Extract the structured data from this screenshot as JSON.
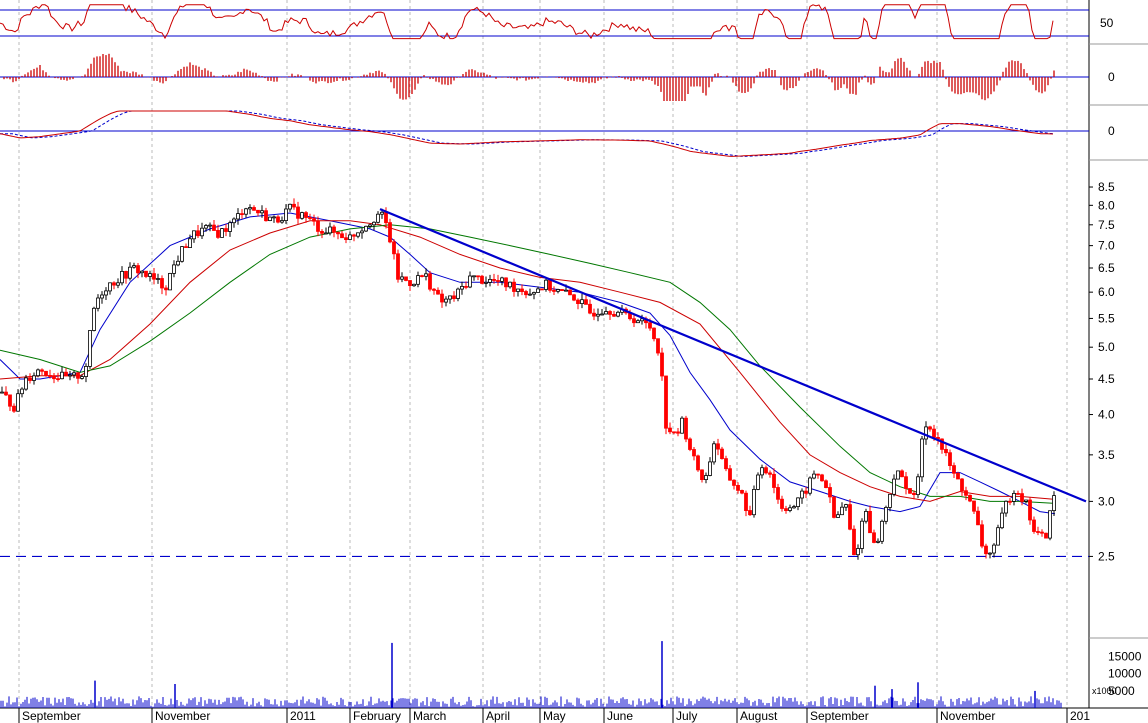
{
  "chart_data": [
    {
      "type": "line",
      "panel": "rsi",
      "y_ticks": [
        {
          "value": 50,
          "label": "50"
        }
      ],
      "reference_lines": [
        40,
        60
      ],
      "line_color": "#cc0000",
      "ref_color": "#0000cc"
    },
    {
      "type": "bar",
      "panel": "macd-histogram",
      "y_ticks": [
        {
          "value": 0,
          "label": "0"
        }
      ],
      "bar_color": "#cc0000"
    },
    {
      "type": "line",
      "panel": "macd",
      "y_ticks": [
        {
          "value": 0,
          "label": "0"
        }
      ],
      "line_color": "#cc0000",
      "signal_color": "#0000cc"
    },
    {
      "type": "candlestick",
      "panel": "price",
      "log_scale": true,
      "ylim": [
        2.2,
        8.7
      ],
      "y_ticks": [
        {
          "value": 8.5,
          "label": "8.5"
        },
        {
          "value": 8.0,
          "label": "8.0"
        },
        {
          "value": 7.5,
          "label": "7.5"
        },
        {
          "value": 7.0,
          "label": "7.0"
        },
        {
          "value": 6.5,
          "label": "6.5"
        },
        {
          "value": 6.0,
          "label": "6.0"
        },
        {
          "value": 5.5,
          "label": "5.5"
        },
        {
          "value": 5.0,
          "label": "5.0"
        },
        {
          "value": 4.5,
          "label": "4.5"
        },
        {
          "value": 4.0,
          "label": "4.0"
        },
        {
          "value": 3.5,
          "label": "3.5"
        },
        {
          "value": 3.0,
          "label": "3.0"
        },
        {
          "value": 2.5,
          "label": "2.5"
        }
      ],
      "trendline": [
        {
          "x": "2011-02-01",
          "y": 7.9
        },
        {
          "x": "2011-12-27",
          "y": 3.0
        }
      ],
      "support_level": 2.5,
      "moving_averages": [
        {
          "color": "#0000cc",
          "points": [
            [
              0,
              4.8
            ],
            [
              20,
              4.5
            ],
            [
              40,
              4.5
            ],
            [
              60,
              4.55
            ],
            [
              80,
              4.6
            ],
            [
              100,
              5.3
            ],
            [
              130,
              6.2
            ],
            [
              170,
              7.0
            ],
            [
              210,
              7.4
            ],
            [
              250,
              7.7
            ],
            [
              290,
              7.8
            ],
            [
              330,
              7.6
            ],
            [
              370,
              7.4
            ],
            [
              390,
              7.2
            ],
            [
              410,
              6.8
            ],
            [
              430,
              6.4
            ],
            [
              460,
              6.2
            ],
            [
              500,
              6.2
            ],
            [
              540,
              6.1
            ],
            [
              580,
              6.0
            ],
            [
              620,
              5.8
            ],
            [
              650,
              5.6
            ],
            [
              670,
              5.2
            ],
            [
              690,
              4.6
            ],
            [
              710,
              4.2
            ],
            [
              730,
              3.8
            ],
            [
              760,
              3.45
            ],
            [
              790,
              3.2
            ],
            [
              820,
              3.1
            ],
            [
              850,
              3.0
            ],
            [
              870,
              2.95
            ],
            [
              900,
              2.9
            ],
            [
              920,
              2.95
            ],
            [
              940,
              3.3
            ],
            [
              960,
              3.3
            ],
            [
              980,
              3.2
            ],
            [
              1000,
              3.1
            ],
            [
              1020,
              3.0
            ],
            [
              1040,
              2.9
            ],
            [
              1055,
              2.88
            ]
          ]
        },
        {
          "color": "#cc0000",
          "points": [
            [
              0,
              4.5
            ],
            [
              40,
              4.55
            ],
            [
              80,
              4.55
            ],
            [
              110,
              4.8
            ],
            [
              150,
              5.4
            ],
            [
              190,
              6.2
            ],
            [
              230,
              6.9
            ],
            [
              270,
              7.3
            ],
            [
              310,
              7.6
            ],
            [
              350,
              7.6
            ],
            [
              380,
              7.5
            ],
            [
              420,
              7.2
            ],
            [
              460,
              6.8
            ],
            [
              500,
              6.5
            ],
            [
              540,
              6.3
            ],
            [
              580,
              6.2
            ],
            [
              620,
              6.0
            ],
            [
              660,
              5.8
            ],
            [
              700,
              5.4
            ],
            [
              740,
              4.6
            ],
            [
              780,
              3.9
            ],
            [
              810,
              3.5
            ],
            [
              840,
              3.3
            ],
            [
              870,
              3.15
            ],
            [
              900,
              3.05
            ],
            [
              930,
              3.0
            ],
            [
              960,
              3.1
            ],
            [
              990,
              3.05
            ],
            [
              1020,
              3.05
            ],
            [
              1055,
              3.02
            ]
          ]
        },
        {
          "color": "#007700",
          "points": [
            [
              0,
              4.95
            ],
            [
              40,
              4.8
            ],
            [
              80,
              4.6
            ],
            [
              110,
              4.7
            ],
            [
              150,
              5.1
            ],
            [
              190,
              5.6
            ],
            [
              230,
              6.2
            ],
            [
              270,
              6.8
            ],
            [
              310,
              7.2
            ],
            [
              350,
              7.4
            ],
            [
              390,
              7.5
            ],
            [
              430,
              7.4
            ],
            [
              470,
              7.2
            ],
            [
              510,
              7.0
            ],
            [
              550,
              6.8
            ],
            [
              590,
              6.6
            ],
            [
              630,
              6.4
            ],
            [
              670,
              6.2
            ],
            [
              700,
              5.8
            ],
            [
              730,
              5.3
            ],
            [
              760,
              4.7
            ],
            [
              800,
              4.1
            ],
            [
              840,
              3.6
            ],
            [
              870,
              3.3
            ],
            [
              900,
              3.15
            ],
            [
              930,
              3.05
            ],
            [
              960,
              3.05
            ],
            [
              990,
              3.0
            ],
            [
              1020,
              3.0
            ],
            [
              1055,
              2.98
            ]
          ]
        }
      ],
      "price_path": [
        [
          0,
          4.3
        ],
        [
          15,
          4.1
        ],
        [
          25,
          4.5
        ],
        [
          40,
          4.65
        ],
        [
          55,
          4.55
        ],
        [
          70,
          4.5
        ],
        [
          85,
          4.6
        ],
        [
          95,
          5.8
        ],
        [
          105,
          6.1
        ],
        [
          120,
          6.3
        ],
        [
          135,
          6.5
        ],
        [
          150,
          6.3
        ],
        [
          165,
          6.1
        ],
        [
          175,
          6.6
        ],
        [
          190,
          7.2
        ],
        [
          205,
          7.4
        ],
        [
          220,
          7.3
        ],
        [
          235,
          7.6
        ],
        [
          245,
          8.0
        ],
        [
          260,
          7.8
        ],
        [
          275,
          7.6
        ],
        [
          290,
          7.9
        ],
        [
          305,
          7.7
        ],
        [
          320,
          7.4
        ],
        [
          335,
          7.3
        ],
        [
          350,
          7.2
        ],
        [
          365,
          7.5
        ],
        [
          380,
          7.8
        ],
        [
          388,
          7.4
        ],
        [
          392,
          6.9
        ],
        [
          398,
          6.3
        ],
        [
          410,
          6.2
        ],
        [
          425,
          6.35
        ],
        [
          440,
          5.8
        ],
        [
          455,
          5.9
        ],
        [
          470,
          6.3
        ],
        [
          485,
          6.25
        ],
        [
          500,
          6.2
        ],
        [
          515,
          6.1
        ],
        [
          530,
          6.0
        ],
        [
          545,
          6.15
        ],
        [
          560,
          6.0
        ],
        [
          575,
          5.9
        ],
        [
          590,
          5.6
        ],
        [
          605,
          5.7
        ],
        [
          620,
          5.6
        ],
        [
          635,
          5.5
        ],
        [
          650,
          5.35
        ],
        [
          660,
          4.9
        ],
        [
          665,
          3.9
        ],
        [
          675,
          3.7
        ],
        [
          682,
          3.9
        ],
        [
          695,
          3.4
        ],
        [
          705,
          3.2
        ],
        [
          715,
          3.7
        ],
        [
          725,
          3.3
        ],
        [
          740,
          3.1
        ],
        [
          750,
          2.85
        ],
        [
          760,
          3.4
        ],
        [
          770,
          3.3
        ],
        [
          780,
          2.95
        ],
        [
          795,
          2.95
        ],
        [
          805,
          3.1
        ],
        [
          815,
          3.3
        ],
        [
          825,
          3.2
        ],
        [
          835,
          2.8
        ],
        [
          845,
          3.0
        ],
        [
          855,
          2.45
        ],
        [
          865,
          2.95
        ],
        [
          875,
          2.55
        ],
        [
          885,
          2.9
        ],
        [
          895,
          3.3
        ],
        [
          905,
          3.2
        ],
        [
          915,
          3.0
        ],
        [
          925,
          3.9
        ],
        [
          935,
          3.75
        ],
        [
          945,
          3.5
        ],
        [
          955,
          3.25
        ],
        [
          965,
          3.1
        ],
        [
          975,
          2.85
        ],
        [
          985,
          2.5
        ],
        [
          995,
          2.6
        ],
        [
          1005,
          2.95
        ],
        [
          1015,
          3.15
        ],
        [
          1025,
          3.0
        ],
        [
          1035,
          2.7
        ],
        [
          1045,
          2.65
        ],
        [
          1055,
          3.1
        ]
      ],
      "candle_up_color": "#000000",
      "candle_down_color": "#ff0000",
      "trendline_color": "#0000cc"
    },
    {
      "type": "bar",
      "panel": "volume",
      "y_ticks": [
        {
          "value": 15000,
          "label": "15000"
        },
        {
          "value": 10000,
          "label": "10000"
        },
        {
          "value": 5000,
          "label": "5000"
        }
      ],
      "unit_label": "x1000",
      "spikes": [
        [
          95,
          8000
        ],
        [
          175,
          7000
        ],
        [
          392,
          19000
        ],
        [
          662,
          19500
        ],
        [
          875,
          6500
        ],
        [
          892,
          5500
        ],
        [
          918,
          7500
        ],
        [
          1035,
          5000
        ]
      ],
      "bar_color": "#0000cc"
    }
  ],
  "x_axis": {
    "labels": [
      {
        "x": 22,
        "text": "September"
      },
      {
        "x": 155,
        "text": "November"
      },
      {
        "x": 290,
        "text": "2011"
      },
      {
        "x": 353,
        "text": "February"
      },
      {
        "x": 413,
        "text": "March"
      },
      {
        "x": 486,
        "text": "April"
      },
      {
        "x": 543,
        "text": "May"
      },
      {
        "x": 607,
        "text": "June"
      },
      {
        "x": 676,
        "text": "July"
      },
      {
        "x": 740,
        "text": "August"
      },
      {
        "x": 810,
        "text": "September"
      },
      {
        "x": 940,
        "text": "November"
      },
      {
        "x": 1070,
        "text": "201"
      }
    ]
  }
}
